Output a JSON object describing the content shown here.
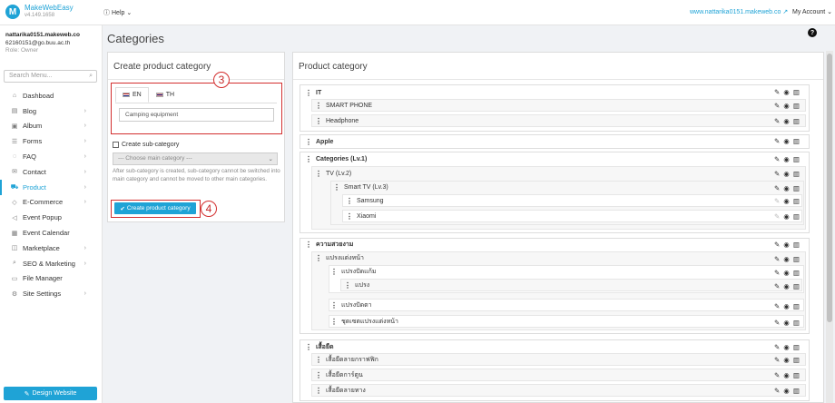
{
  "app": {
    "logo_letter": "M",
    "name": "MakeWebEasy",
    "version": "v4.149.1658",
    "help_label": "Help",
    "site_link": "www.nattarika0151.makeweb.co",
    "account_label": "My Account"
  },
  "user": {
    "site": "nattarika0151.makeweb.co",
    "email": "62160151@go.buu.ac.th",
    "role": "Role: Owner"
  },
  "sidebar": {
    "search_placeholder": "Search Menu...",
    "items": [
      {
        "label": "Dashboad",
        "icon": "home-icon"
      },
      {
        "label": "Blog",
        "icon": "document-icon"
      },
      {
        "label": "Album",
        "icon": "image-icon"
      },
      {
        "label": "Forms",
        "icon": "list-icon"
      },
      {
        "label": "FAQ",
        "icon": "chat-icon"
      },
      {
        "label": "Contact",
        "icon": "mail-icon"
      },
      {
        "label": "Product",
        "icon": "cart-icon"
      },
      {
        "label": "E-Commerce",
        "icon": "tag-icon"
      },
      {
        "label": "Event Popup",
        "icon": "megaphone-icon"
      },
      {
        "label": "Event Calendar",
        "icon": "calendar-icon"
      },
      {
        "label": "Marketplace",
        "icon": "bag-icon"
      },
      {
        "label": "SEO & Marketing",
        "icon": "search-icon"
      },
      {
        "label": "File Manager",
        "icon": "folder-icon"
      },
      {
        "label": "Site Settings",
        "icon": "gear-icon"
      }
    ],
    "design_button": "Design Website"
  },
  "page": {
    "title": "Categories"
  },
  "create_panel": {
    "title": "Create product category",
    "tabs": [
      "EN",
      "TH"
    ],
    "name_value": "Camping equipment",
    "subcategory_label": "Create sub-category",
    "main_category_placeholder": "--- Choose main category ---",
    "hint": "After sub-category is created, sub-category cannot be switched into main category and cannot be moved to other main categories.",
    "create_button": "Create product category",
    "badge_lang": "3",
    "badge_create": "4"
  },
  "category_panel": {
    "title": "Product category",
    "labels": {
      "it": "IT",
      "smartphone": "SMART PHONE",
      "headphone": "Headphone",
      "apple": "Apple",
      "lv1": "Categories (Lv.1)",
      "lv2": "TV (Lv.2)",
      "lv3": "Smart TV (Lv.3)",
      "samsung": "Samsung",
      "xiaomi": "Xiaomi",
      "beauty": "ความสวยงาม",
      "makeup_brush": "แปรงแต่งหน้า",
      "brush_flat": "แปรงปัดแก้ม",
      "brush": "แปรง",
      "eye_brush": "แปรงปัดตา",
      "brush_set": "ชุดเซตแปรงแต่งหน้า",
      "shirts": "เสื้อยืด",
      "graphic_shirt": "เสื้อยืดลายกราฟฟิก",
      "cartoon_shirt": "เสื้อยืดการ์ตูน",
      "striped_shirt": "เสื้อยืดลายทาง"
    }
  }
}
